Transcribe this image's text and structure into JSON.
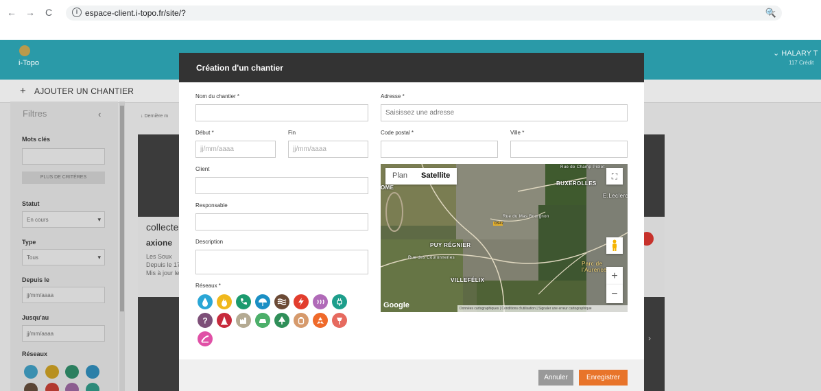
{
  "browser": {
    "url": "espace-client.i-topo.fr/site/?",
    "info_glyph": "i",
    "zoom_glyph": "🔍"
  },
  "app": {
    "logo_text": "i-Topo",
    "user_name": "HALARY T",
    "user_credits": "117 Crédit",
    "add_site_label": "AJOUTER UN CHANTIER",
    "header_color": "#2a9aa8",
    "sidebar": {
      "title": "Filtres",
      "keywords_label": "Mots clés",
      "more_criteria_label": "PLUS DE CRITÈRES",
      "status_label": "Statut",
      "status_value": "En cours",
      "type_label": "Type",
      "type_value": "Tous",
      "since_label": "Depuis le",
      "since_placeholder": "jj/mm/aaaa",
      "until_label": "Jusqu'au",
      "until_placeholder": "jj/mm/aaaa",
      "networks_label": "Réseaux"
    },
    "list": {
      "sort_label": "Dernière m",
      "card": {
        "title": "collecte",
        "subtitle": "axione",
        "location": "Les Soux",
        "since": "Depuis le 17",
        "updated": "Mis à jour le"
      }
    }
  },
  "modal": {
    "title": "Création d'un chantier",
    "fields": {
      "name_label": "Nom du chantier *",
      "name_value": "",
      "address_label": "Adresse *",
      "address_placeholder": "Saisissez une adresse",
      "start_label": "Début *",
      "start_placeholder": "jj/mm/aaaa",
      "end_label": "Fin",
      "end_placeholder": "jj/mm/aaaa",
      "postal_label": "Code postal *",
      "postal_value": "",
      "city_label": "Ville *",
      "city_value": "",
      "client_label": "Client",
      "client_value": "",
      "manager_label": "Responsable",
      "manager_value": "",
      "description_label": "Description",
      "description_value": "",
      "networks_label": "Réseaux *"
    },
    "networks": [
      {
        "icon": "water-drop-icon",
        "color": "#2aa6d6",
        "glyph": "drop"
      },
      {
        "icon": "gas-icon",
        "color": "#f0b81c",
        "glyph": "flame"
      },
      {
        "icon": "telecom-icon",
        "color": "#1b9a6e",
        "glyph": "phone"
      },
      {
        "icon": "rainwater-icon",
        "color": "#1a8fc4",
        "glyph": "umbrella"
      },
      {
        "icon": "sewage-icon",
        "color": "#6b4a35",
        "glyph": "waves"
      },
      {
        "icon": "electricity-icon",
        "color": "#e23d2d",
        "glyph": "bolt"
      },
      {
        "icon": "heating-icon",
        "color": "#b06ab8",
        "glyph": "heat"
      },
      {
        "icon": "charging-icon",
        "color": "#1d9e8b",
        "glyph": "plug"
      },
      {
        "icon": "unknown-icon",
        "color": "#7d4f78",
        "glyph": "?"
      },
      {
        "icon": "hydrocarbon-icon",
        "color": "#c72a3c",
        "glyph": "cone"
      },
      {
        "icon": "industrial-icon",
        "color": "#b4aa92",
        "glyph": "factory"
      },
      {
        "icon": "transport-icon",
        "color": "#4caf6a",
        "glyph": "car"
      },
      {
        "icon": "vegetation-icon",
        "color": "#2f8f59",
        "glyph": "tree"
      },
      {
        "icon": "fuel-icon",
        "color": "#d69a6c",
        "glyph": "jar"
      },
      {
        "icon": "recycling-icon",
        "color": "#ef6a2a",
        "glyph": "recycle"
      },
      {
        "icon": "lighting-icon",
        "color": "#e66a5f",
        "glyph": "lamp"
      },
      {
        "icon": "signage-icon",
        "color": "#e050a6",
        "glyph": "road"
      }
    ],
    "map": {
      "tab_plan": "Plan",
      "tab_satellite": "Satellite",
      "places": [
        "BUXEROLLES",
        "E.Leclerc",
        "PUY RÉGNIER",
        "VILLEFÉLIX",
        "Parc de",
        "l'Aurence",
        "Rue du Mas Bourgnon",
        "Rue des Couronneries",
        "Rue de Champ Piolet",
        "D947",
        "OME"
      ],
      "google": "Google",
      "footer": "Données cartographiques  |  Conditions d'utilisation  |  Signaler une erreur cartographique",
      "zoom_in": "+",
      "zoom_out": "−"
    },
    "cancel_label": "Annuler",
    "save_label": "Enregistrer"
  }
}
